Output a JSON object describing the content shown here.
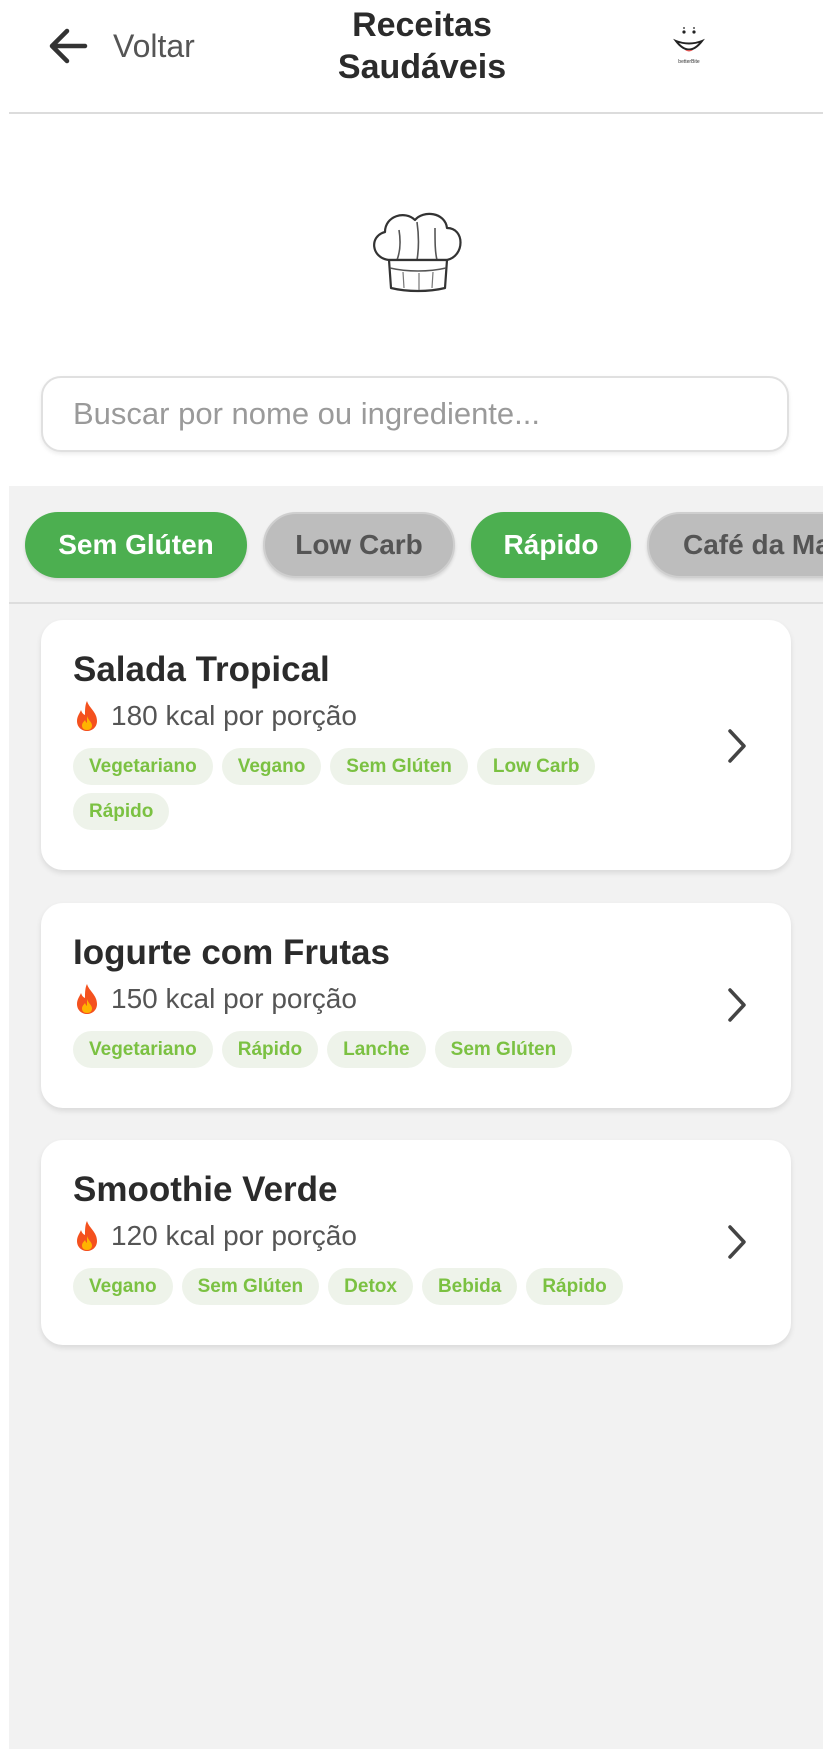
{
  "header": {
    "back_label": "Voltar",
    "title_line1": "Receitas",
    "title_line2": "Saudáveis",
    "logo_text": "betterBite"
  },
  "search": {
    "placeholder": "Buscar por nome ou ingrediente..."
  },
  "filters": [
    {
      "label": "Sem Glúten",
      "active": true
    },
    {
      "label": "Low Carb",
      "active": false
    },
    {
      "label": "Rápido",
      "active": true
    },
    {
      "label": "Café da Ma",
      "active": false
    }
  ],
  "recipes": [
    {
      "title": "Salada Tropical",
      "kcal": "180 kcal por porção",
      "tags": [
        "Vegetariano",
        "Vegano",
        "Sem Glúten",
        "Low Carb",
        "Rápido"
      ]
    },
    {
      "title": "Iogurte com Frutas",
      "kcal": "150 kcal por porção",
      "tags": [
        "Vegetariano",
        "Rápido",
        "Lanche",
        "Sem Glúten"
      ]
    },
    {
      "title": "Smoothie Verde",
      "kcal": "120 kcal por porção",
      "tags": [
        "Vegano",
        "Sem Glúten",
        "Detox",
        "Bebida",
        "Rápido"
      ]
    }
  ],
  "colors": {
    "accent": "#4caf50",
    "chip_inactive": "#bdbdbd",
    "tag_text": "#7bc142",
    "tag_bg": "#eef3ea",
    "background": "#f2f2f2"
  },
  "icons": {
    "back": "arrow-left-icon",
    "logo": "smiley-logo",
    "hero": "chef-hat-icon",
    "calories": "fire-icon",
    "open": "chevron-right-icon"
  }
}
